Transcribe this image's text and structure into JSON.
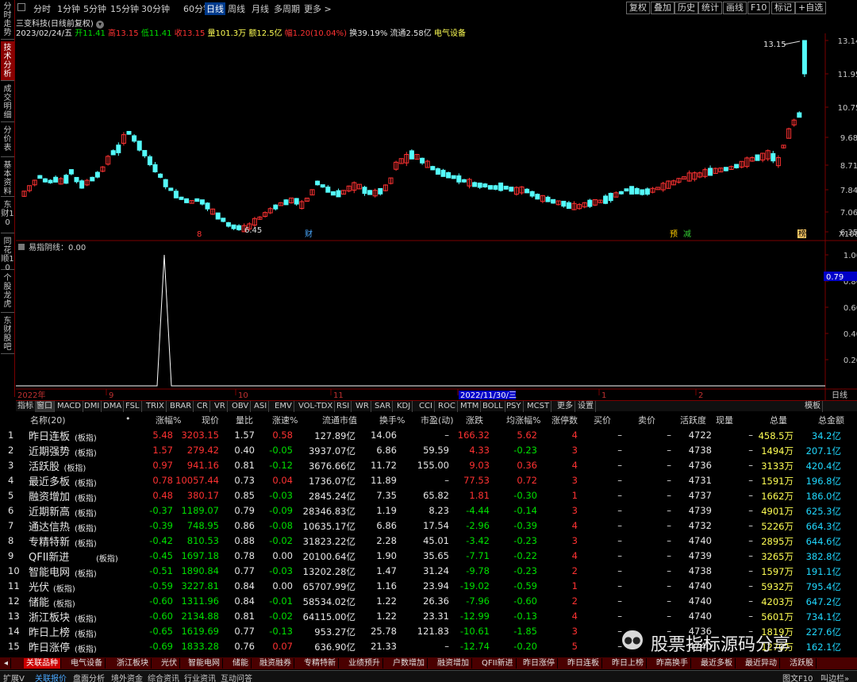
{
  "side_tabs": [
    "分时走势",
    "技术分析",
    "成交明细",
    "分价表",
    "基本资料",
    "东财10",
    "同花顺10",
    "个股龙虎",
    "东财股吧"
  ],
  "active_side_tab": 1,
  "topbar": {
    "periods": [
      "分时",
      "1分钟",
      "5分钟",
      "15分钟",
      "30分钟",
      "60分钟",
      "日线",
      "周线",
      "月线",
      "多周期",
      "更多 >"
    ],
    "active_period": 6,
    "right_buttons": [
      "复权",
      "叠加",
      "历史",
      "统计",
      "画线",
      "F10",
      "标记",
      "+自选"
    ]
  },
  "info": {
    "title": "三变科技(日线前复权)",
    "date": "2023/02/24/五",
    "open_label": "开",
    "open": "11.41",
    "high_label": "高",
    "high": "13.15",
    "low_label": "低",
    "low": "11.41",
    "close_label": "收",
    "close": "13.15",
    "vol_label": "量",
    "vol": "101.3万",
    "amt_label": "额",
    "amt": "12.5亿",
    "chg_label": "幅",
    "chg": "1.20(10.04%)",
    "turn_label": "换",
    "turn": "39.19%",
    "float_label": "流通",
    "float": "2.58亿",
    "sector": "电气设备"
  },
  "price_axis": [
    "13.14",
    "11.95",
    "10.75",
    "9.68",
    "8.71",
    "7.84",
    "7.06",
    "6.35"
  ],
  "axis_unit": "X100",
  "markers": {
    "high_label": "13.15",
    "low_label": "6.45",
    "tags": [
      "8",
      "财",
      "预",
      "减",
      "榜"
    ]
  },
  "indicator": {
    "title": "易指阴线：0.00",
    "axis": [
      "1.00",
      "0.80",
      "0.60",
      "0.40",
      "0.20"
    ],
    "cursor_value": "0.79"
  },
  "date_axis": {
    "labels": [
      "2022年",
      "9",
      "10",
      "11",
      "2022/11/30/三",
      "1",
      "2"
    ],
    "right": "日线"
  },
  "indicators": [
    "指标",
    "窗口",
    "MACD",
    "DMI",
    "DMA",
    "FSL",
    "TRIX",
    "BRAR",
    "CR",
    "VR",
    "OBV",
    "ASI",
    "EMV",
    "VOL-TDX",
    "RSI",
    "WR",
    "SAR",
    "KDJ",
    "CCI",
    "ROC",
    "MTM",
    "BOLL",
    "PSY",
    "MCST",
    "更多",
    "设置"
  ],
  "indicator_right": "模板",
  "table": {
    "headers": [
      "名称(20)",
      "•",
      "涨幅%",
      "现价",
      "量比",
      "涨速%",
      "流通市值",
      "换手%",
      "市盈(动)",
      "涨跌",
      "均涨幅%",
      "涨停数",
      "买价",
      "卖价",
      "活跃度",
      "现量",
      "总量",
      "总金额"
    ],
    "rows": [
      [
        "1",
        "昨日连板",
        "(板指)",
        "5.48",
        "3203.15",
        "1.57",
        "0.58",
        "127.89亿",
        "14.06",
        "–",
        "166.32",
        "5.62",
        "4",
        "–",
        "–",
        "4722",
        "–",
        "458.5万",
        "34.2亿"
      ],
      [
        "2",
        "近期强势",
        "(板指)",
        "1.57",
        "279.42",
        "0.40",
        "-0.05",
        "3937.07亿",
        "6.86",
        "59.59",
        "4.33",
        "-0.23",
        "3",
        "–",
        "–",
        "4738",
        "–",
        "1494万",
        "207.1亿"
      ],
      [
        "3",
        "活跃股",
        "(板指)",
        "0.97",
        "941.16",
        "0.81",
        "-0.12",
        "3676.66亿",
        "11.72",
        "155.00",
        "9.03",
        "0.36",
        "4",
        "–",
        "–",
        "4736",
        "–",
        "3133万",
        "420.4亿"
      ],
      [
        "4",
        "最近多板",
        "(板指)",
        "0.78",
        "10057.44",
        "0.73",
        "0.04",
        "1736.07亿",
        "11.89",
        "–",
        "77.53",
        "0.72",
        "3",
        "–",
        "–",
        "4731",
        "–",
        "1591万",
        "196.8亿"
      ],
      [
        "5",
        "融资增加",
        "(板指)",
        "0.48",
        "380.17",
        "0.85",
        "-0.03",
        "2845.24亿",
        "7.35",
        "65.82",
        "1.81",
        "-0.30",
        "1",
        "–",
        "–",
        "4737",
        "–",
        "1662万",
        "186.0亿"
      ],
      [
        "6",
        "近期新高",
        "(板指)",
        "-0.37",
        "1189.07",
        "0.79",
        "-0.09",
        "28346.83亿",
        "1.19",
        "8.23",
        "-4.44",
        "-0.14",
        "3",
        "–",
        "–",
        "4739",
        "–",
        "4901万",
        "625.3亿"
      ],
      [
        "7",
        "通达信热",
        "(板指)",
        "-0.39",
        "748.95",
        "0.86",
        "-0.08",
        "10635.17亿",
        "6.86",
        "17.54",
        "-2.96",
        "-0.39",
        "4",
        "–",
        "–",
        "4732",
        "–",
        "5226万",
        "664.3亿"
      ],
      [
        "8",
        "专精特新",
        "(板指)",
        "-0.42",
        "810.53",
        "0.88",
        "-0.02",
        "31823.22亿",
        "2.28",
        "45.01",
        "-3.42",
        "-0.23",
        "3",
        "–",
        "–",
        "4740",
        "–",
        "2895万",
        "644.6亿"
      ],
      [
        "9",
        "QFII新进",
        "(板指)",
        "-0.45",
        "1697.18",
        "0.78",
        "0.00",
        "20100.64亿",
        "1.90",
        "35.65",
        "-7.71",
        "-0.22",
        "4",
        "–",
        "–",
        "4739",
        "–",
        "3265万",
        "382.8亿"
      ],
      [
        "10",
        "智能电网",
        "(板指)",
        "-0.51",
        "1890.84",
        "0.77",
        "-0.03",
        "13202.28亿",
        "1.47",
        "31.24",
        "-9.78",
        "-0.23",
        "2",
        "–",
        "–",
        "4738",
        "–",
        "1597万",
        "191.1亿"
      ],
      [
        "11",
        "光伏",
        "(板指)",
        "-0.59",
        "3227.81",
        "0.84",
        "0.00",
        "65707.99亿",
        "1.16",
        "23.94",
        "-19.02",
        "-0.59",
        "1",
        "–",
        "–",
        "4740",
        "–",
        "5932万",
        "795.4亿"
      ],
      [
        "12",
        "储能",
        "(板指)",
        "-0.60",
        "1311.96",
        "0.84",
        "-0.01",
        "58534.02亿",
        "1.22",
        "26.36",
        "-7.96",
        "-0.60",
        "2",
        "–",
        "–",
        "4740",
        "–",
        "4203万",
        "647.2亿"
      ],
      [
        "13",
        "浙江板块",
        "(板指)",
        "-0.60",
        "2134.88",
        "0.81",
        "-0.02",
        "64115.00亿",
        "1.22",
        "23.31",
        "-12.99",
        "-0.13",
        "4",
        "–",
        "–",
        "4740",
        "–",
        "5601万",
        "734.1亿"
      ],
      [
        "14",
        "昨日上榜",
        "(板指)",
        "-0.65",
        "1619.69",
        "0.77",
        "-0.13",
        "953.27亿",
        "25.78",
        "121.83",
        "-10.61",
        "-1.85",
        "3",
        "–",
        "–",
        "4736",
        "–",
        "1819万",
        "227.6亿"
      ],
      [
        "15",
        "昨日涨停",
        "(板指)",
        "-0.69",
        "1833.28",
        "0.76",
        "0.07",
        "636.90亿",
        "21.33",
        "–",
        "-12.74",
        "-0.20",
        "5",
        "–",
        "–",
        "4740",
        "–",
        "1270万",
        "162.1亿"
      ]
    ]
  },
  "bottom_tabs": [
    "关联品种",
    "电气设备",
    "浙江板块",
    "光伏",
    "智能电网",
    "储能",
    "融资融券",
    "专精特新",
    "业绩预升",
    "户数增加",
    "融资增加",
    "QFII新进",
    "昨日涨停",
    "昨日连板",
    "昨日上榜",
    "昨高换手",
    "最近多板",
    "最近异动",
    "活跃股"
  ],
  "status": {
    "left": [
      "扩展V",
      "关联报价",
      "盘面分析",
      "境外资金",
      "综合资讯",
      "行业资讯",
      "互动问答"
    ],
    "right": "图文F10",
    "right2": "叫边栏»"
  },
  "watermark": "股票指标源码分享",
  "colors": {
    "up": "#ff3232",
    "down": "#00e000",
    "candle_down": "#54fcfc",
    "bg": "#000000",
    "border": "#7a0000"
  }
}
